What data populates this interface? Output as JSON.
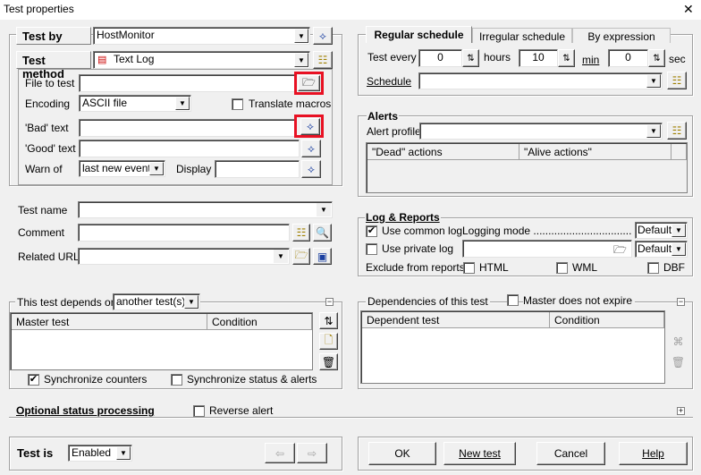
{
  "window": {
    "title": "Test properties",
    "close": "✕"
  },
  "test_by": {
    "label": "Test by",
    "value": "HostMonitor"
  },
  "test_method": {
    "label": "Test method",
    "value": "Text Log"
  },
  "file_to_test": {
    "label": "File to test",
    "value": ""
  },
  "encoding": {
    "label": "Encoding",
    "value": "ASCII file",
    "translate_macros": "Translate macros"
  },
  "bad_text": {
    "label": "'Bad' text",
    "value": ""
  },
  "good_text": {
    "label": "'Good' text",
    "value": ""
  },
  "warn_of": {
    "label": "Warn of",
    "value": "last new event",
    "display_label": "Display",
    "display_value": ""
  },
  "test_name": {
    "label": "Test name",
    "value": ""
  },
  "comment": {
    "label": "Comment",
    "value": ""
  },
  "related_url": {
    "label": "Related URL",
    "value": ""
  },
  "depends": {
    "label": "This test depends on",
    "value": "another test(s)",
    "columns": [
      "Master test",
      "Condition"
    ],
    "sync_counters": "Synchronize counters",
    "sync_status": "Synchronize status & alerts"
  },
  "optional": {
    "label": "Optional status processing",
    "reverse_alert": "Reverse alert"
  },
  "test_is": {
    "label": "Test is",
    "value": "Enabled"
  },
  "buttons": {
    "ok": "OK",
    "new_test": "New test",
    "cancel": "Cancel",
    "help": "Help"
  },
  "schedule": {
    "tabs": [
      "Regular schedule",
      "Irregular schedule",
      "By expression"
    ],
    "test_every": "Test every",
    "hours": "0",
    "hours_label": "hours",
    "min": "10",
    "min_label": "min",
    "sec": "0",
    "sec_label": "sec",
    "schedule_label": "Schedule",
    "schedule_value": ""
  },
  "alerts": {
    "title": "Alerts",
    "profile_label": "Alert profile",
    "profile_value": "",
    "columns": [
      "\"Dead\" actions",
      "\"Alive actions\""
    ]
  },
  "log": {
    "title": "Log & Reports",
    "use_common": "Use common log",
    "logging_mode": "Logging mode ........................................",
    "mode1": "Default",
    "use_private": "Use private log",
    "mode2": "Default",
    "exclude": "Exclude from reports:",
    "html": "HTML",
    "wml": "WML",
    "dbf": "DBF"
  },
  "deps": {
    "title": "Dependencies of this test",
    "master_not_expire": "Master does not expire",
    "columns": [
      "Dependent test",
      "Condition"
    ]
  }
}
